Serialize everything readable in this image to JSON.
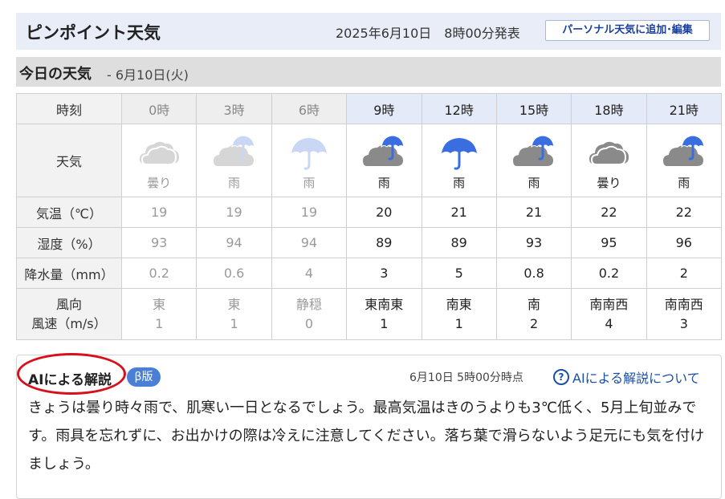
{
  "header": {
    "title": "ピンポイント天気",
    "issued": "2025年6月10日　8時00分発表",
    "personal_button": "パーソナル天気に追加･編集"
  },
  "today": {
    "title": "今日の天気",
    "date": " - 6月10日(火)"
  },
  "forecast": {
    "row_labels": {
      "time": "時刻",
      "weather": "天気",
      "temp": "気温（℃）",
      "humidity": "湿度（%）",
      "precip": "降水量（mm）",
      "wind_dir": "風向",
      "wind_speed": "風速（m/s）"
    },
    "columns": [
      {
        "time": "0時",
        "weather": "曇り",
        "icon": "cloud-icon",
        "temp": "19",
        "humidity": "93",
        "precip": "0.2",
        "wind_dir": "東",
        "wind_speed": "1",
        "past": true
      },
      {
        "time": "3時",
        "weather": "雨",
        "icon": "cloud-umbrella-icon",
        "temp": "19",
        "humidity": "94",
        "precip": "0.6",
        "wind_dir": "東",
        "wind_speed": "1",
        "past": true
      },
      {
        "time": "6時",
        "weather": "雨",
        "icon": "umbrella-icon",
        "temp": "19",
        "humidity": "94",
        "precip": "4",
        "wind_dir": "静穏",
        "wind_speed": "0",
        "past": true
      },
      {
        "time": "9時",
        "weather": "雨",
        "icon": "cloud-umbrella-icon",
        "temp": "20",
        "humidity": "89",
        "precip": "3",
        "wind_dir": "東南東",
        "wind_speed": "1",
        "past": false
      },
      {
        "time": "12時",
        "weather": "雨",
        "icon": "umbrella-icon",
        "temp": "21",
        "humidity": "89",
        "precip": "5",
        "wind_dir": "南東",
        "wind_speed": "1",
        "past": false
      },
      {
        "time": "15時",
        "weather": "雨",
        "icon": "cloud-umbrella-icon",
        "temp": "21",
        "humidity": "93",
        "precip": "0.8",
        "wind_dir": "南",
        "wind_speed": "2",
        "past": false
      },
      {
        "time": "18時",
        "weather": "曇り",
        "icon": "cloud-icon",
        "temp": "22",
        "humidity": "95",
        "precip": "0.2",
        "wind_dir": "南南西",
        "wind_speed": "4",
        "past": false
      },
      {
        "time": "21時",
        "weather": "雨",
        "icon": "cloud-umbrella-icon",
        "temp": "22",
        "humidity": "96",
        "precip": "2",
        "wind_dir": "南南西",
        "wind_speed": "3",
        "past": false
      }
    ]
  },
  "ai": {
    "title": "AIによる解説",
    "badge": "β版",
    "time": "6月10日 5時00分時点",
    "help_icon_glyph": "?",
    "help_link": "AIによる解説について",
    "text": "きょうは曇り時々雨で、肌寒い一日となるでしょう。最高気温はきのうよりも3℃低く、5月上旬並みです。雨具を忘れずに、お出かけの際は冷えに注意してください。落ち葉で滑らないよう足元にも気を付けましょう。"
  },
  "colors": {
    "umbrella_blue": "#3a6ee0",
    "cloud_gray_current": "#8a8a8a",
    "cloud_gray_past": "#d6d6d6",
    "circle_red": "#d7101b",
    "link_blue": "#1a4fa6"
  }
}
